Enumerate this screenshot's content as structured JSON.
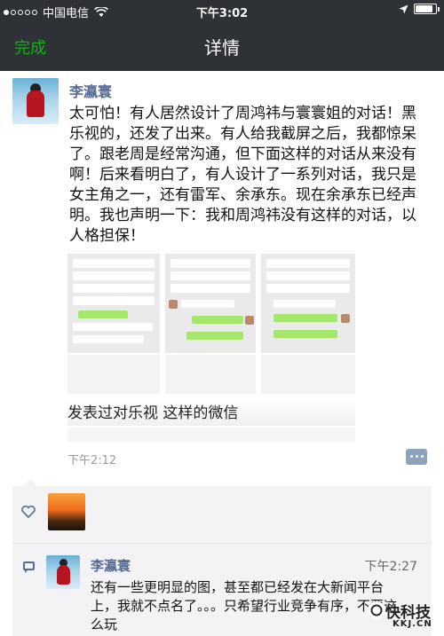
{
  "status_bar": {
    "carrier": "中国电信",
    "time": "下午3:02",
    "battery_level": 0.85
  },
  "nav": {
    "done_label": "完成",
    "title": "详情"
  },
  "post": {
    "author": "李瀛寰",
    "text": "太可怕！有人居然设计了周鸿祎与寰寰姐的对话！黑乐视的，还发了出来。有人给我截屏之后，我都惊呆了。跟老周是经常沟通，但下面这样的对话从来没有啊！后来看明白了，有人设计了一系列对话，我只是女主角之一，还有雷军、余承东。现在余承东已经声明。我也声明一下：我和周鸿祎没有这样的对话，以人格担保！",
    "image_caption": "发表过对乐视 这样的微信",
    "time": "下午2:12"
  },
  "comments": [
    {
      "author": "李瀛寰",
      "time": "下午2:27",
      "text": "还有一些更明显的图，甚至都已经发在大新闻平台上，我就不点名了。。。只希望行业竞争有序，不要这么玩"
    }
  ],
  "watermark": {
    "name": "快科技",
    "domain": "KKJ.CN"
  },
  "icons": {
    "like": "heart-outline-icon",
    "comment": "speech-bubble-icon",
    "wifi": "wifi-icon",
    "location": "location-arrow-icon",
    "battery": "battery-icon"
  },
  "colors": {
    "accent_green": "#1aad19",
    "link_blue": "#576b95",
    "bar_dark": "#2e3135"
  }
}
